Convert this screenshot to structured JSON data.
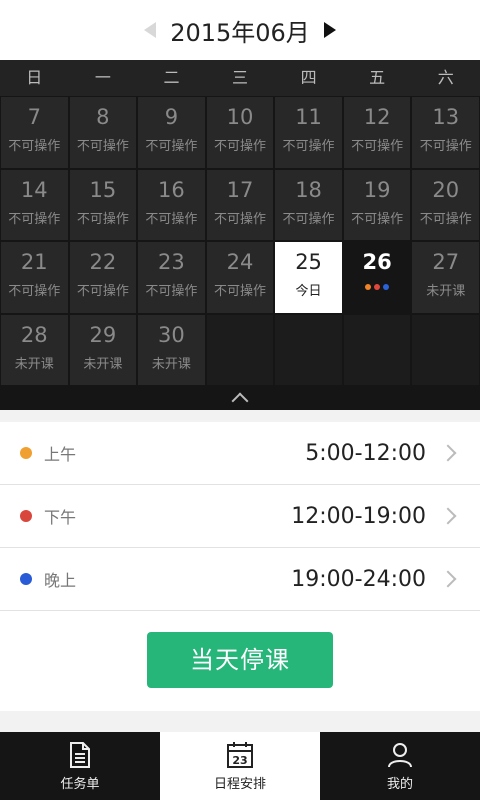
{
  "header": {
    "month": "2015年06月",
    "prev_icon": "triangle-left-icon",
    "next_icon": "triangle-right-icon"
  },
  "weekdays": [
    "日",
    "一",
    "二",
    "三",
    "四",
    "五",
    "六"
  ],
  "days": [
    {
      "num": "7",
      "sub": "不可操作",
      "state": "disabled"
    },
    {
      "num": "8",
      "sub": "不可操作",
      "state": "disabled"
    },
    {
      "num": "9",
      "sub": "不可操作",
      "state": "disabled"
    },
    {
      "num": "10",
      "sub": "不可操作",
      "state": "disabled"
    },
    {
      "num": "11",
      "sub": "不可操作",
      "state": "disabled"
    },
    {
      "num": "12",
      "sub": "不可操作",
      "state": "disabled"
    },
    {
      "num": "13",
      "sub": "不可操作",
      "state": "disabled"
    },
    {
      "num": "14",
      "sub": "不可操作",
      "state": "disabled"
    },
    {
      "num": "15",
      "sub": "不可操作",
      "state": "disabled"
    },
    {
      "num": "16",
      "sub": "不可操作",
      "state": "disabled"
    },
    {
      "num": "17",
      "sub": "不可操作",
      "state": "disabled"
    },
    {
      "num": "18",
      "sub": "不可操作",
      "state": "disabled"
    },
    {
      "num": "19",
      "sub": "不可操作",
      "state": "disabled"
    },
    {
      "num": "20",
      "sub": "不可操作",
      "state": "disabled"
    },
    {
      "num": "21",
      "sub": "不可操作",
      "state": "disabled"
    },
    {
      "num": "22",
      "sub": "不可操作",
      "state": "disabled"
    },
    {
      "num": "23",
      "sub": "不可操作",
      "state": "disabled"
    },
    {
      "num": "24",
      "sub": "不可操作",
      "state": "disabled"
    },
    {
      "num": "25",
      "sub": "今日",
      "state": "today"
    },
    {
      "num": "26",
      "sub": "",
      "state": "active",
      "dots": [
        "#f0822a",
        "#e0483d",
        "#2a63d9"
      ]
    },
    {
      "num": "27",
      "sub": "未开课",
      "state": "normal"
    },
    {
      "num": "28",
      "sub": "未开课",
      "state": "normal"
    },
    {
      "num": "29",
      "sub": "未开课",
      "state": "normal"
    },
    {
      "num": "30",
      "sub": "未开课",
      "state": "normal"
    },
    {
      "num": "",
      "sub": "",
      "state": "empty"
    },
    {
      "num": "",
      "sub": "",
      "state": "empty"
    },
    {
      "num": "",
      "sub": "",
      "state": "empty"
    },
    {
      "num": "",
      "sub": "",
      "state": "empty"
    }
  ],
  "sessions": [
    {
      "label": "上午",
      "time": "5:00-12:00",
      "color": "#f0a030"
    },
    {
      "label": "下午",
      "time": "12:00-19:00",
      "color": "#d9463c"
    },
    {
      "label": "晚上",
      "time": "19:00-24:00",
      "color": "#2a5bd7"
    }
  ],
  "action": {
    "suspend_label": "当天停课",
    "color": "#27b67a"
  },
  "tabs": [
    {
      "label": "任务单",
      "icon": "document-icon",
      "active": false
    },
    {
      "label": "日程安排",
      "icon": "calendar-icon",
      "active": true,
      "icon_text": "23"
    },
    {
      "label": "我的",
      "icon": "user-icon",
      "active": false
    }
  ]
}
